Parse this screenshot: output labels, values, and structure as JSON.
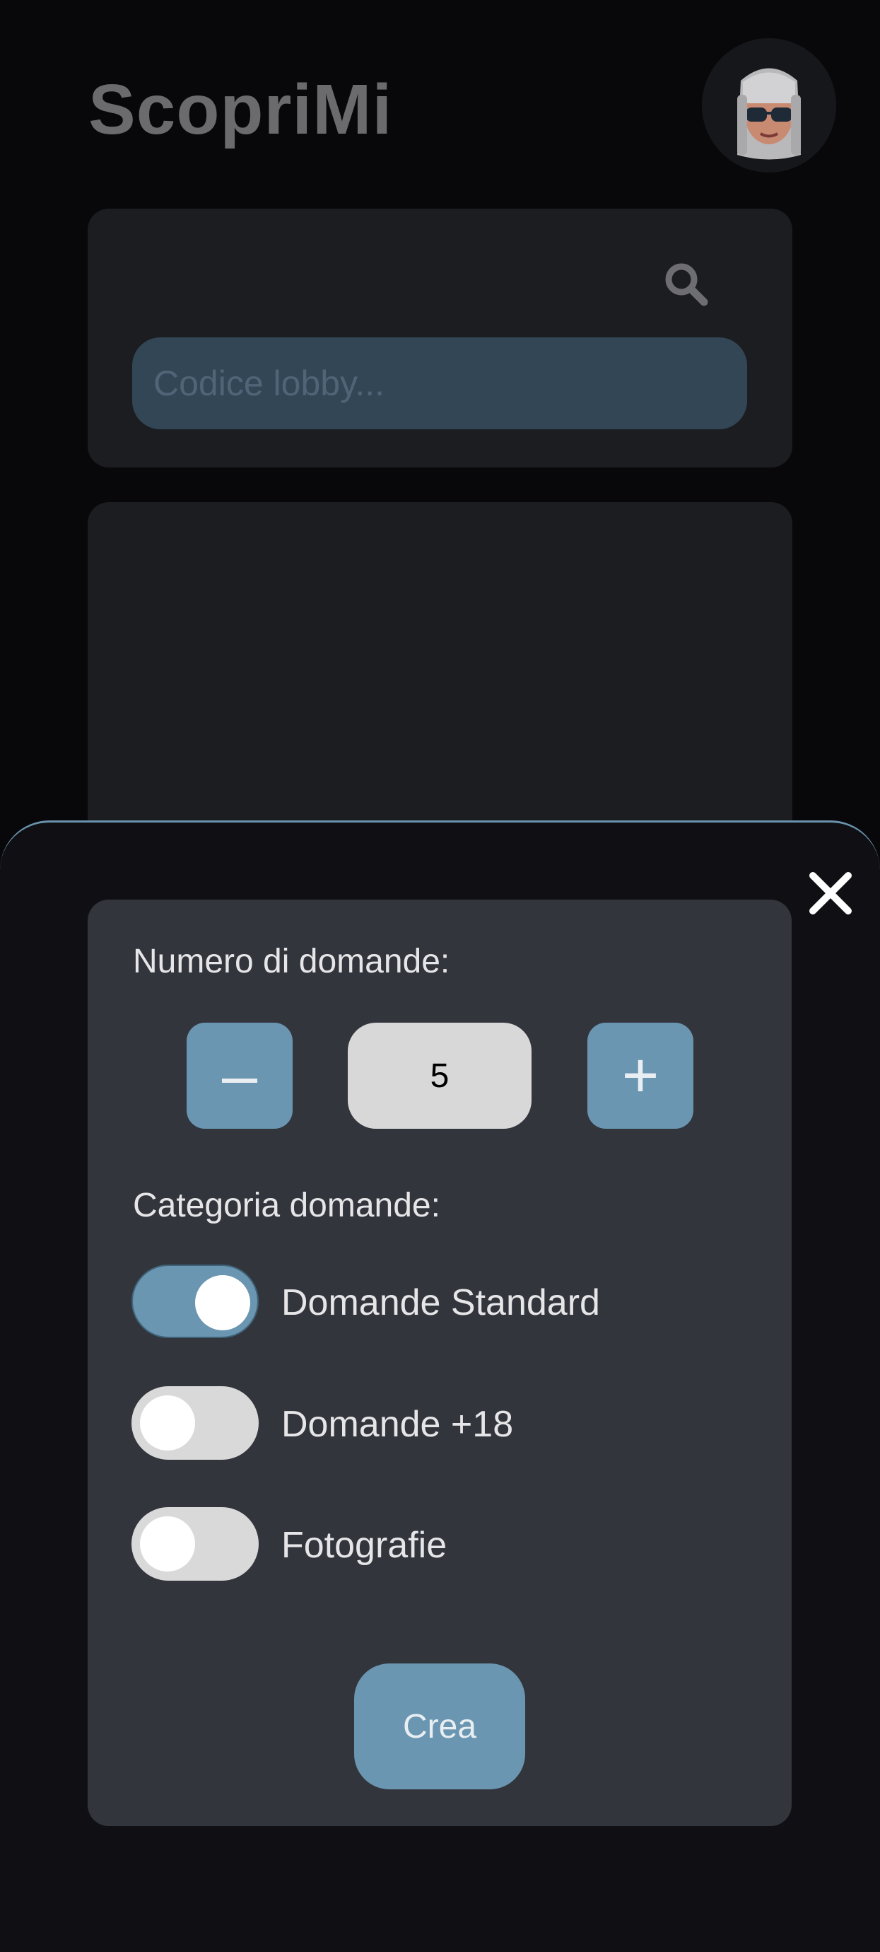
{
  "app": {
    "title": "ScopriMi"
  },
  "search": {
    "placeholder": "Codice lobby..."
  },
  "sheet": {
    "questions_label": "Numero di domande:",
    "minus_label": "–",
    "plus_label": "+",
    "question_count": "5",
    "category_label": "Categoria domande:",
    "categories": [
      {
        "label": "Domande Standard",
        "enabled": true
      },
      {
        "label": "Domande +18",
        "enabled": false
      },
      {
        "label": "Fotografie",
        "enabled": false
      }
    ],
    "create_label": "Crea"
  },
  "colors": {
    "accent": "#6a96b1",
    "background": "#08080a",
    "panel": "#33353d",
    "toggle_off": "#d9d9d9"
  },
  "icons": [
    "search-icon",
    "close-icon",
    "avatar"
  ]
}
